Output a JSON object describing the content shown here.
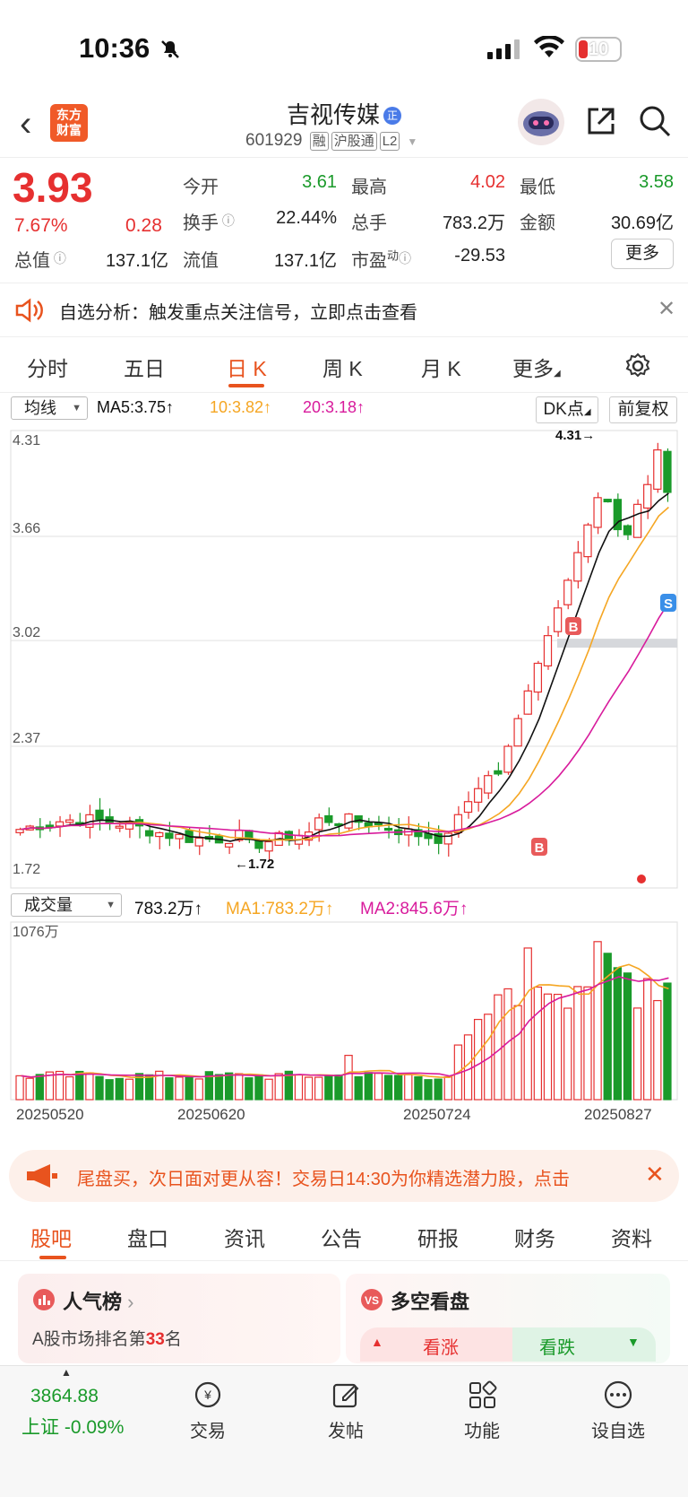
{
  "status": {
    "time": "10:36",
    "battery": "10"
  },
  "header": {
    "logo": "东方\n财富",
    "stock_name": "吉视传媒",
    "name_badge": "正",
    "code": "601929",
    "tags": [
      "融",
      "沪股通",
      "L2"
    ]
  },
  "quote": {
    "price": "3.93",
    "change_pct": "7.67%",
    "change": "0.28",
    "open_label": "今开",
    "open": "3.61",
    "high_label": "最高",
    "high": "4.02",
    "low_label": "最低",
    "low": "3.58",
    "turnover_label": "换手",
    "turnover": "22.44%",
    "volume_label": "总手",
    "volume": "783.2万",
    "amount_label": "金额",
    "amount": "30.69亿",
    "total_cap_label": "总值",
    "total_cap": "137.1亿",
    "float_cap_label": "流值",
    "float_cap": "137.1亿",
    "pe_label": "市盈",
    "pe_sup": "动",
    "pe": "-29.53",
    "more_label": "更多"
  },
  "notice": {
    "text": "自选分析：触发重点关注信号，立即点击查看"
  },
  "tabs": [
    "分时",
    "五日",
    "日 K",
    "周 K",
    "月 K",
    "更多"
  ],
  "ma_bar": {
    "selector": "均线",
    "ma5": "MA5:3.75↑",
    "ma10": "10:3.82↑",
    "ma20": "20:3.18↑",
    "dk": "DK点",
    "fq": "前复权"
  },
  "kline": {
    "y_labels": [
      "4.31",
      "3.66",
      "3.02",
      "2.37",
      "1.72"
    ],
    "max_label": "4.31→",
    "min_label": "←1.72",
    "markers": [
      "B",
      "B",
      "S"
    ]
  },
  "volume_bar": {
    "selector": "成交量",
    "vol": "783.2万↑",
    "ma1": "MA1:783.2万↑",
    "ma2": "MA2:845.6万↑",
    "y_max": "1076万"
  },
  "dates": [
    "20250520",
    "20250620",
    "20250724",
    "20250827"
  ],
  "colors": {
    "up": "#e63030",
    "down": "#1a9a2a",
    "ma5": "#111111",
    "ma10": "#f5a623",
    "ma20": "#d81b9c",
    "accent": "#e8531e"
  },
  "banner": {
    "text": "尾盘买，次日面对更从容！交易日14:30为你精选潜力股，点击"
  },
  "sub_tabs": [
    "股吧",
    "盘口",
    "资讯",
    "公告",
    "研报",
    "财务",
    "资料"
  ],
  "cards": {
    "rank_title": "人气榜",
    "rank_text_pre": "A股市场排名第",
    "rank_num": "33",
    "rank_text_post": "名",
    "bull_title": "多空看盘",
    "bull_up": "看涨",
    "bull_down": "看跌"
  },
  "bottom_nav": {
    "index_value": "3864.88",
    "index_label": "上证 -0.09%",
    "items": [
      "交易",
      "发帖",
      "功能",
      "设自选"
    ]
  }
}
